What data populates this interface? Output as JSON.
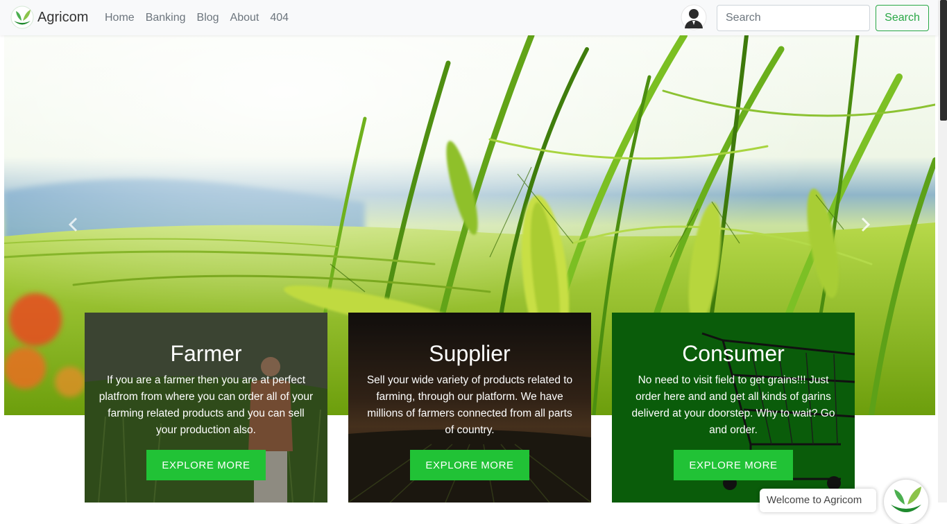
{
  "brand": {
    "name": "Agricom",
    "logo_icon": "leaf-logo-icon"
  },
  "nav": {
    "items": [
      {
        "label": "Home"
      },
      {
        "label": "Banking"
      },
      {
        "label": "Blog"
      },
      {
        "label": "About"
      },
      {
        "label": "404"
      }
    ]
  },
  "user": {
    "icon": "user-avatar-icon"
  },
  "search": {
    "placeholder": "Search",
    "button_label": "Search"
  },
  "hero": {
    "prev_icon": "chevron-left-icon",
    "next_icon": "chevron-right-icon"
  },
  "cards": [
    {
      "title": "Farmer",
      "text": "If you are a farmer then you are at perfect platfrom from where you can order all of your farming related products and you can sell your production also.",
      "button": "EXPLORE MORE"
    },
    {
      "title": "Supplier",
      "text": "Sell your wide variety of products related to farming, through our platform. We have millions of farmers connected from all parts of country.",
      "button": "EXPLORE MORE"
    },
    {
      "title": "Consumer",
      "text": "No need to visit field to get grains!!! Just order here and and get all kinds of garins deliverd at your doorstep. Why to wait? Go and order.",
      "button": "EXPLORE MORE"
    }
  ],
  "chat": {
    "greeting": "Welcome to Agricom"
  },
  "colors": {
    "accent": "#28a745",
    "button": "#21c236",
    "consumer_bg": "#0a5c0a"
  }
}
